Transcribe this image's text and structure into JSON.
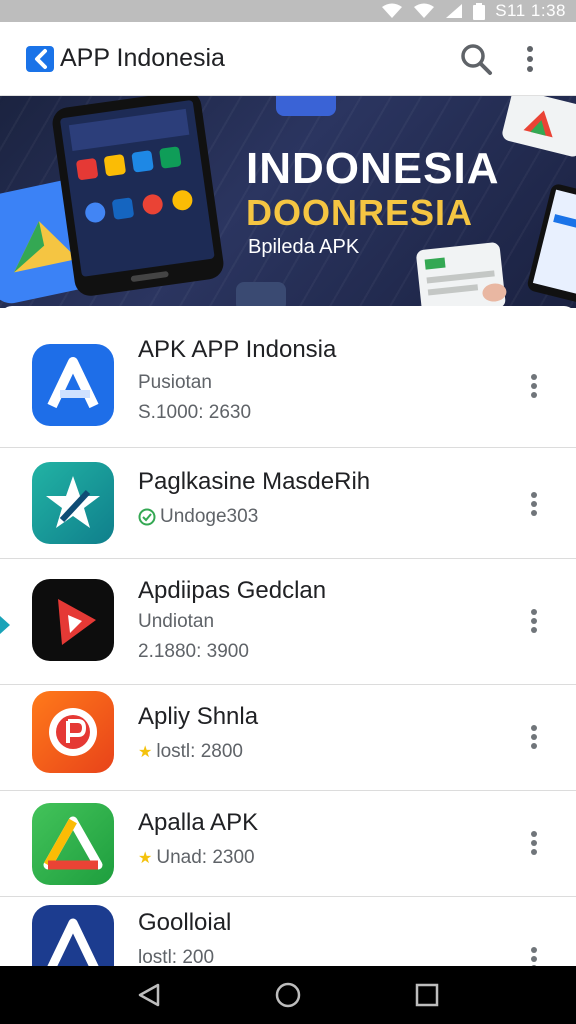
{
  "status_bar": {
    "time": "S11 1:38",
    "icons": [
      "wifi-icon",
      "wifi-icon",
      "signal-icon",
      "battery-icon"
    ]
  },
  "app_bar": {
    "title": "APP Indonesia",
    "logo_icon": "app-logo-icon",
    "actions": [
      "search-icon",
      "more-vert-icon"
    ]
  },
  "banner": {
    "headline": "INDONESIA",
    "headline2": "DOONRESIA",
    "subtitle": "Bpileda APK"
  },
  "apps": [
    {
      "name": "APK APP Indonsia",
      "meta": "Pusiotan",
      "meta_icon": "",
      "stats": "S.1000: 2630",
      "icon": "blue-a-icon"
    },
    {
      "name": "Paglkasine MasdeRih",
      "meta": "Undoge303",
      "meta_icon": "check-circle-icon",
      "stats": "",
      "icon": "teal-star-icon"
    },
    {
      "name": "Apdiipas Gedclan",
      "meta": "Undiotan",
      "meta_icon": "",
      "stats": "2.1880: 3900",
      "icon": "red-play-icon"
    },
    {
      "name": "Apliy Shnla",
      "meta": "lostl: 2800",
      "meta_icon": "star-icon",
      "stats": "",
      "icon": "orange-badge-icon"
    },
    {
      "name": "Apalla APK",
      "meta": "Unad: 2300",
      "meta_icon": "star-icon",
      "stats": "",
      "icon": "green-triangle-icon"
    },
    {
      "name": "Goolloial",
      "meta": "lostl: 200",
      "meta_icon": "",
      "stats": "",
      "icon": "navy-a-icon"
    }
  ],
  "nav_bar": [
    "back-icon",
    "home-icon",
    "recents-icon"
  ],
  "colors": {
    "accent": "#1a73e8",
    "banner_bg": "#1b2340",
    "banner_gold": "#f5c542",
    "star": "#f4c20d",
    "check": "#34a853"
  }
}
